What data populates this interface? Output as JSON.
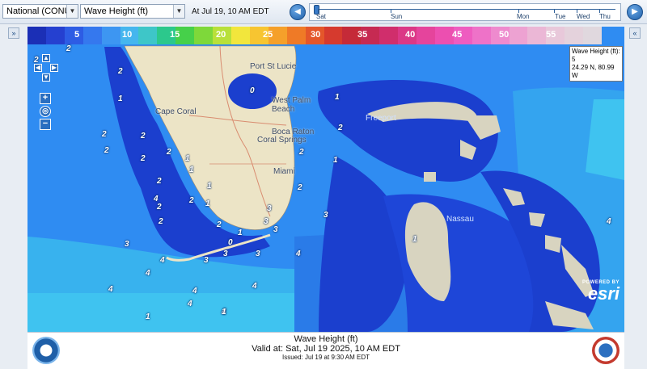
{
  "toolbar": {
    "region_select": "National (CONUS",
    "parameter_select": "Wave Height (ft)",
    "valid_time": "At Jul 19, 10 AM EDT",
    "timeline_labels": [
      "Sat",
      "Sun",
      "Mon",
      "Tue",
      "Wed",
      "Thu"
    ]
  },
  "side": {
    "left_toggle": "»",
    "right_toggle": "«"
  },
  "legend": {
    "labels": [
      "5",
      "10",
      "15",
      "20",
      "25",
      "30",
      "35",
      "40",
      "45",
      "50",
      "55"
    ],
    "colors": [
      "#1b2fb6",
      "#2540d0",
      "#2d5ce4",
      "#3578ee",
      "#3d96f2",
      "#45b6ee",
      "#3ec6c8",
      "#2cc88c",
      "#46d04a",
      "#7ed83a",
      "#b8e03a",
      "#f2e63c",
      "#f7c531",
      "#f5a02a",
      "#ef7a26",
      "#e4562a",
      "#d63a2e",
      "#c52a38",
      "#c62a52",
      "#d02e6c",
      "#db3886",
      "#e5449c",
      "#ec4fb0",
      "#ee5cc0",
      "#ee72c8",
      "#ee8ace",
      "#eda2d2",
      "#ebb7d6",
      "#e8c8da",
      "#e4d2dc",
      "#e0d8de"
    ]
  },
  "identify": {
    "line1": "Wave Height (ft): 5",
    "line2": "24.29 N, 80.99 W"
  },
  "map_places": [
    "Port St Lucie",
    "West Palm Beach",
    "Cape Coral",
    "Boca Raton",
    "Coral Springs",
    "Miami",
    "Freeport",
    "Nassau"
  ],
  "wave_labels": [
    "2",
    "2",
    "2",
    "1",
    "2",
    "0",
    "1",
    "2",
    "2",
    "2",
    "2",
    "1",
    "2",
    "2",
    "2",
    "2",
    "2",
    "1",
    "1",
    "2",
    "1",
    "3",
    "2",
    "1",
    "3",
    "0",
    "3",
    "3",
    "2",
    "3",
    "3",
    "4",
    "4",
    "4",
    "4",
    "4",
    "4",
    "4",
    "3",
    "3",
    "4",
    "4",
    "1",
    "1",
    "1",
    "1",
    "4"
  ],
  "esri": {
    "powered": "POWERED BY",
    "brand": "esri"
  },
  "caption": {
    "title": "Wave Height (ft)",
    "valid": "Valid at: Sat, Jul 19 2025, 10 AM EDT",
    "issued": "Issued: Jul 19 at 9:30 AM EDT"
  },
  "colors": {
    "ocean_shallow": "#2d86f0",
    "ocean_deep": "#1a3fc9",
    "land": "#ece4c6",
    "accent": "#2b6fc0"
  }
}
